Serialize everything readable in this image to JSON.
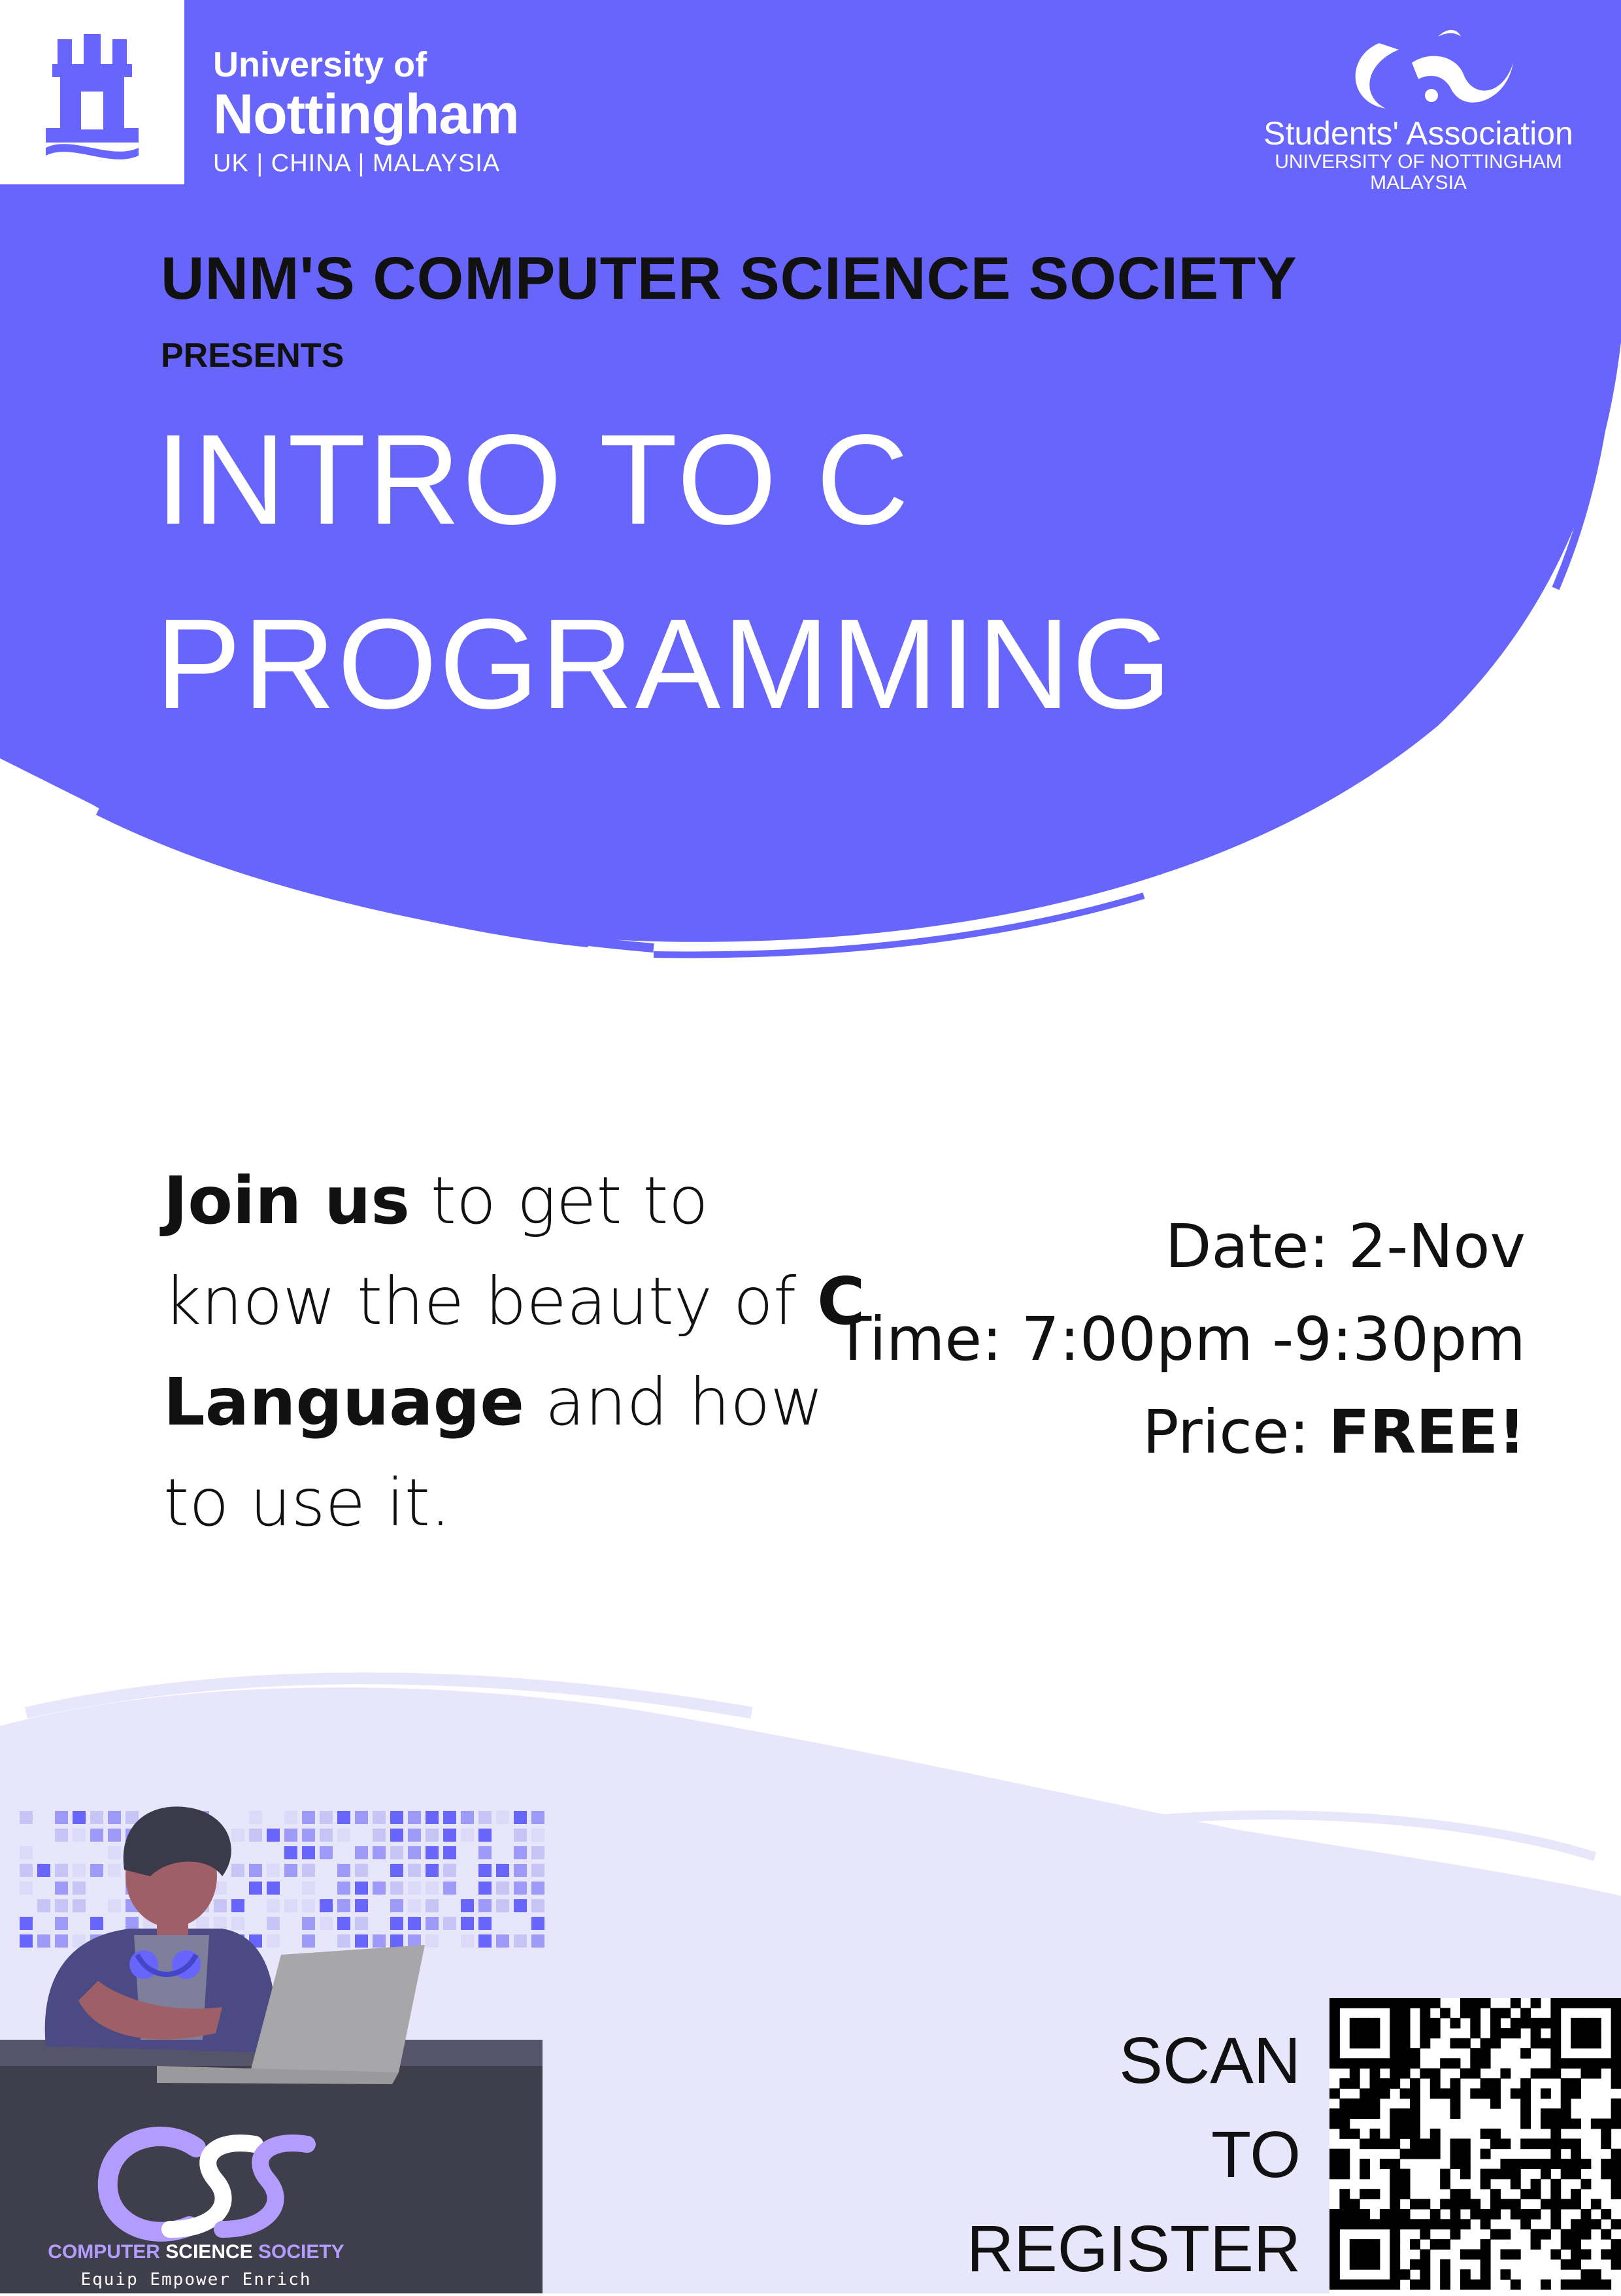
{
  "colors": {
    "brand_purple": "#6865fd",
    "lavender": "#e8e6fa",
    "desk_dark": "#3f3e4b",
    "accent_lilac": "#b49cff",
    "text_dark": "#111111"
  },
  "logos": {
    "university": {
      "line1": "University of",
      "line2": "Nottingham",
      "line3": "UK | CHINA | MALAYSIA"
    },
    "students_association": {
      "line1": "Students' Association",
      "line2": "UNIVERSITY OF NOTTINGHAM",
      "line3": "MALAYSIA"
    },
    "society": {
      "name_part1": "COMPUTER ",
      "name_part2": "SCIENCE",
      "name_part3": " SOCIETY",
      "tagline": "Equip Empower Enrich"
    }
  },
  "header": {
    "society": "UNM'S COMPUTER SCIENCE SOCIETY",
    "presents": "PRESENTS",
    "title_line1": "INTRO TO C",
    "title_line2": "PROGRAMMING"
  },
  "blurb": {
    "bold1": "Join us",
    "text1": " to get to know the beauty of ",
    "bold2": "C Language",
    "text2": " and how to use it."
  },
  "details": {
    "date_label": "Date: ",
    "date_value": "2-Nov",
    "time_label": "Time: ",
    "time_value": "7:00pm -9:30pm",
    "price_label": "Price: ",
    "price_value": "FREE!"
  },
  "register": {
    "line1": "SCAN",
    "line2": "TO",
    "line3": "REGISTER"
  }
}
